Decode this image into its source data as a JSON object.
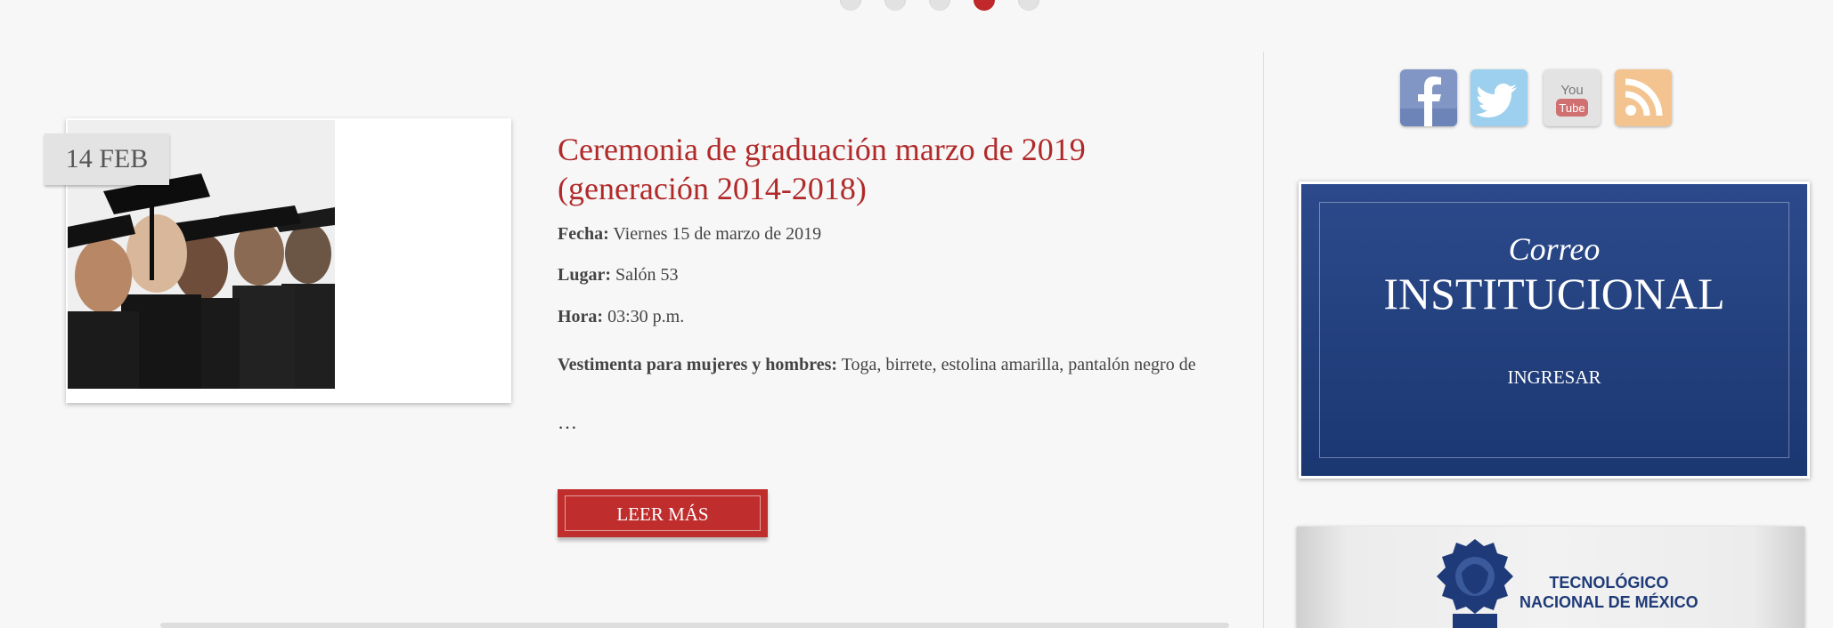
{
  "slider": {
    "dot_count": 5,
    "active_index": 3
  },
  "article": {
    "date_badge": "14 FEB",
    "title": "Ceremonia de graduación marzo de 2019 (generación 2014-2018)",
    "fecha_label": "Fecha:",
    "fecha_value": "Viernes 15 de marzo de 2019",
    "lugar_label": "Lugar:",
    "lugar_value": "Salón 53",
    "hora_label": "Hora:",
    "hora_value": "03:30 p.m.",
    "vestimenta_label": "Vestimenta para mujeres y hombres:",
    "vestimenta_value": "Toga, birrete, estolina amarilla, pantalón negro de",
    "ellipsis": "…",
    "read_more": "LEER MÁS"
  },
  "sidebar": {
    "social": [
      {
        "name": "facebook-icon",
        "glyph": "f",
        "color": "#8196c4"
      },
      {
        "name": "twitter-icon",
        "glyph": "t",
        "color": "#9dd0ef"
      },
      {
        "name": "youtube-icon",
        "glyph": "You Tube",
        "color": "#e3e3e3"
      },
      {
        "name": "rss-icon",
        "glyph": "rss",
        "color": "#f3c490"
      }
    ],
    "mail": {
      "line1": "Correo",
      "line2": "INSTITUCIONAL",
      "button": "INGRESAR"
    },
    "tec": {
      "line1": "TECNOLÓGICO",
      "line2": "NACIONAL DE MÉXICO"
    }
  },
  "colors": {
    "accent": "#c0282a",
    "title": "#b12a2a",
    "mail_bg": "#1f3b78"
  }
}
